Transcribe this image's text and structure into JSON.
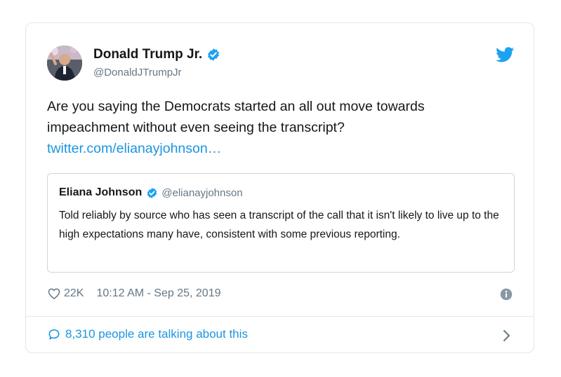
{
  "tweet": {
    "author_name": "Donald Trump Jr.",
    "author_handle": "@DonaldJTrumpJr",
    "text": "Are you saying the Democrats started an all out move towards impeachment without even seeing the transcript?",
    "link": "twitter.com/elianayjohnson…",
    "likes": "22K",
    "timestamp": "10:12 AM - Sep 25, 2019",
    "discussion": "8,310 people are talking about this"
  },
  "quoted": {
    "author_name": "Eliana Johnson",
    "author_handle": "@elianayjohnson",
    "text": "Told reliably by source who has seen a transcript of the call that it isn't likely to live up to the high expectations many have, consistent with some previous reporting."
  },
  "colors": {
    "twitter_blue": "#1da1f2",
    "link": "#1b95e0",
    "secondary_text": "#657786",
    "border": "#e1e8ed"
  },
  "icons": [
    "avatar",
    "verified-badge-icon",
    "twitter-bird-icon",
    "heart-icon",
    "info-icon",
    "comment-bubble-icon",
    "chevron-right-icon"
  ]
}
